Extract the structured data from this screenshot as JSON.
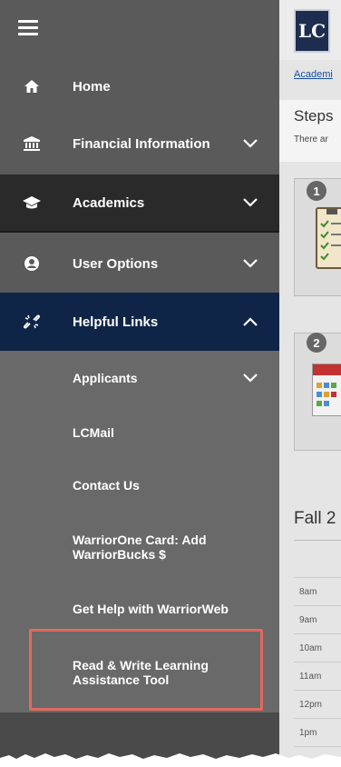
{
  "sidebar": {
    "menu_label": "Menu",
    "items": [
      {
        "label": "Home",
        "icon": "home-icon"
      },
      {
        "label": "Financial Information",
        "icon": "bank-icon",
        "chevron": "down"
      },
      {
        "label": "Academics",
        "icon": "graduation-cap-icon",
        "chevron": "down"
      },
      {
        "label": "User Options",
        "icon": "user-icon",
        "chevron": "down"
      },
      {
        "label": "Helpful Links",
        "icon": "broken-link-icon",
        "chevron": "up"
      }
    ],
    "helpful_links": [
      {
        "label": "Applicants",
        "chevron": "down"
      },
      {
        "label": "LCMail"
      },
      {
        "label": "Contact Us"
      },
      {
        "label": "WarriorOne Card: Add WarriorBucks $"
      },
      {
        "label": "Get Help with WarriorWeb"
      },
      {
        "label": "Read & Write Learning Assistance Tool",
        "highlighted": true
      }
    ]
  },
  "main": {
    "logo_text": "LC",
    "breadcrumb": "Academi",
    "steps_title": "Steps",
    "steps_subtitle": "There ar",
    "step_numbers": [
      "1",
      "2"
    ],
    "schedule_title": "Fall 2",
    "times": [
      "8am",
      "9am",
      "10am",
      "11am",
      "12pm",
      "1pm"
    ]
  },
  "colors": {
    "sidebar": "#5a5a5a",
    "submenu": "#696969",
    "academics_bg": "#2a2a2a",
    "helpful_links_bg": "#0f2547",
    "highlight_border": "#e1695f"
  }
}
